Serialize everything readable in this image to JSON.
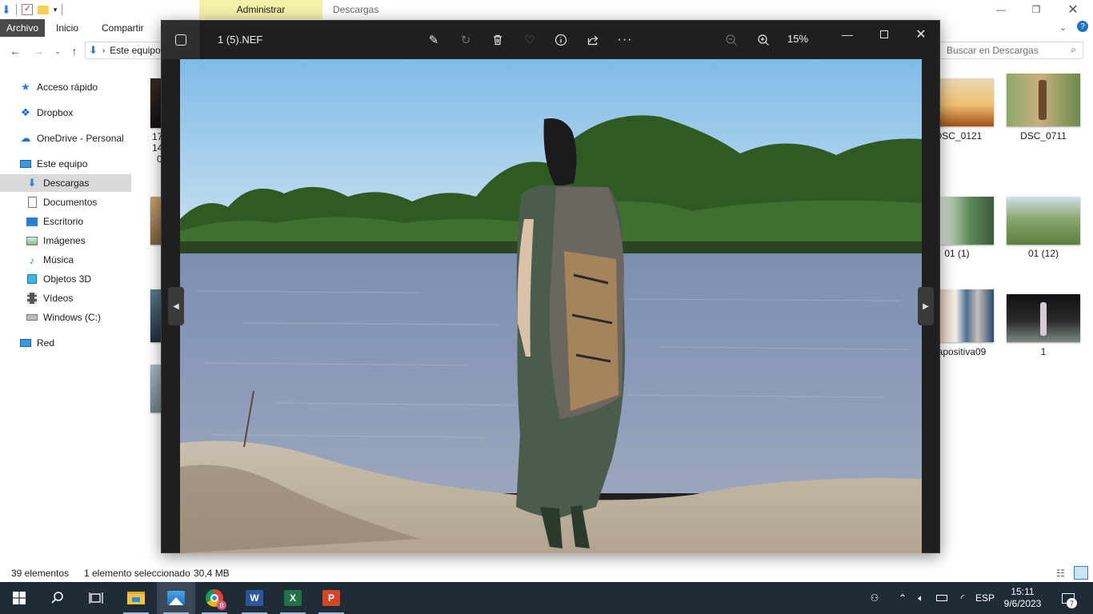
{
  "explorer": {
    "context_tab": "Administrar",
    "window_title": "Descargas",
    "ribbon_tabs": [
      "Archivo",
      "Inicio",
      "Compartir"
    ],
    "address": {
      "segment": "Este equipo"
    },
    "search": {
      "placeholder": "Buscar en Descargas"
    },
    "nav": [
      {
        "label": "Acceso rápido",
        "icon": "star-icon"
      },
      {
        "label": "Dropbox",
        "icon": "dropbox-icon"
      },
      {
        "label": "OneDrive - Personal",
        "icon": "cloud-icon"
      },
      {
        "label": "Este equipo",
        "icon": "computer-icon"
      },
      {
        "label": "Descargas",
        "icon": "download-icon",
        "selected": true
      },
      {
        "label": "Documentos",
        "icon": "document-icon"
      },
      {
        "label": "Escritorio",
        "icon": "desktop-icon"
      },
      {
        "label": "Imágenes",
        "icon": "pictures-icon"
      },
      {
        "label": "Música",
        "icon": "music-icon"
      },
      {
        "label": "Objetos 3D",
        "icon": "cube-icon"
      },
      {
        "label": "Vídeos",
        "icon": "video-icon"
      },
      {
        "label": "Windows (C:)",
        "icon": "drive-icon"
      },
      {
        "label": "Red",
        "icon": "network-icon"
      }
    ],
    "files": [
      {
        "label": "DSC_0121"
      },
      {
        "label": "DSC_0711"
      },
      {
        "label": "01 (1)"
      },
      {
        "label": "01 (12)"
      },
      {
        "label": "apositiva09"
      },
      {
        "label": "1"
      }
    ],
    "left_partial_labels": [
      "17",
      "14",
      "0"
    ],
    "status": {
      "count": "39 elementos",
      "selected": "1 elemento seleccionado",
      "size": "30,4 MB"
    }
  },
  "viewer": {
    "filename": "1 (5).NEF",
    "zoom": "15%",
    "toolbar_icons": [
      "edit-icon",
      "rotate-icon",
      "delete-icon",
      "favorite-icon",
      "info-icon",
      "share-icon",
      "more-icon",
      "zoom-out-icon",
      "zoom-in-icon"
    ]
  },
  "taskbar": {
    "language": "ESP",
    "time": "15:11",
    "date": "9/6/2023",
    "notifications": "7",
    "apps": [
      "start-icon",
      "search-icon",
      "task-view-icon",
      "file-explorer-icon",
      "photos-icon",
      "chrome-icon",
      "word-icon",
      "excel-icon",
      "powerpoint-icon"
    ]
  }
}
